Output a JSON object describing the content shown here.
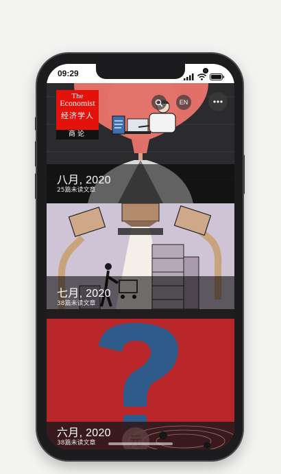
{
  "status_bar": {
    "time": "09:29"
  },
  "header": {
    "logo_en_line1": "The",
    "logo_en_line2": "Economist",
    "logo_cn": "经济学人",
    "section_tag": "商论",
    "language_button": "EN"
  },
  "months": [
    {
      "title": "八月, 2020",
      "subtitle": "25篇未读文章"
    },
    {
      "title": "七月, 2020",
      "subtitle": "38篇未读文章"
    },
    {
      "title": "六月, 2020",
      "subtitle": "38篇未读文章"
    }
  ],
  "colors": {
    "economist_red": "#e3120b",
    "june_bg": "#b8262a",
    "july_bg": "#cfc3d6",
    "august_bg": "#2b2b2e"
  }
}
